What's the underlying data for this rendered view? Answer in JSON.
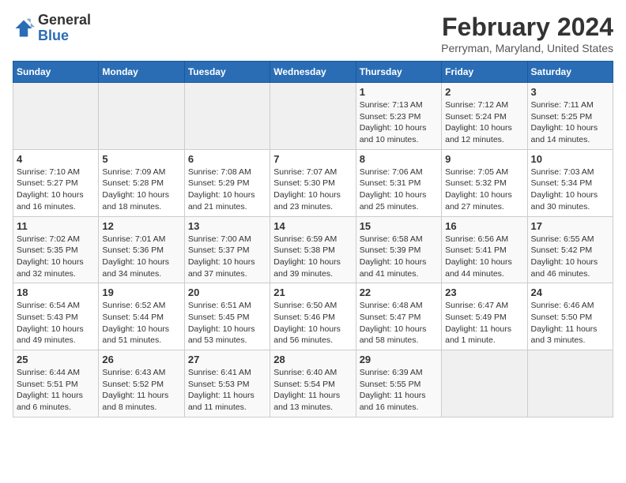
{
  "header": {
    "logo_general": "General",
    "logo_blue": "Blue",
    "month_title": "February 2024",
    "location": "Perryman, Maryland, United States"
  },
  "days_of_week": [
    "Sunday",
    "Monday",
    "Tuesday",
    "Wednesday",
    "Thursday",
    "Friday",
    "Saturday"
  ],
  "weeks": [
    [
      {
        "num": "",
        "detail": ""
      },
      {
        "num": "",
        "detail": ""
      },
      {
        "num": "",
        "detail": ""
      },
      {
        "num": "",
        "detail": ""
      },
      {
        "num": "1",
        "detail": "Sunrise: 7:13 AM\nSunset: 5:23 PM\nDaylight: 10 hours\nand 10 minutes."
      },
      {
        "num": "2",
        "detail": "Sunrise: 7:12 AM\nSunset: 5:24 PM\nDaylight: 10 hours\nand 12 minutes."
      },
      {
        "num": "3",
        "detail": "Sunrise: 7:11 AM\nSunset: 5:25 PM\nDaylight: 10 hours\nand 14 minutes."
      }
    ],
    [
      {
        "num": "4",
        "detail": "Sunrise: 7:10 AM\nSunset: 5:27 PM\nDaylight: 10 hours\nand 16 minutes."
      },
      {
        "num": "5",
        "detail": "Sunrise: 7:09 AM\nSunset: 5:28 PM\nDaylight: 10 hours\nand 18 minutes."
      },
      {
        "num": "6",
        "detail": "Sunrise: 7:08 AM\nSunset: 5:29 PM\nDaylight: 10 hours\nand 21 minutes."
      },
      {
        "num": "7",
        "detail": "Sunrise: 7:07 AM\nSunset: 5:30 PM\nDaylight: 10 hours\nand 23 minutes."
      },
      {
        "num": "8",
        "detail": "Sunrise: 7:06 AM\nSunset: 5:31 PM\nDaylight: 10 hours\nand 25 minutes."
      },
      {
        "num": "9",
        "detail": "Sunrise: 7:05 AM\nSunset: 5:32 PM\nDaylight: 10 hours\nand 27 minutes."
      },
      {
        "num": "10",
        "detail": "Sunrise: 7:03 AM\nSunset: 5:34 PM\nDaylight: 10 hours\nand 30 minutes."
      }
    ],
    [
      {
        "num": "11",
        "detail": "Sunrise: 7:02 AM\nSunset: 5:35 PM\nDaylight: 10 hours\nand 32 minutes."
      },
      {
        "num": "12",
        "detail": "Sunrise: 7:01 AM\nSunset: 5:36 PM\nDaylight: 10 hours\nand 34 minutes."
      },
      {
        "num": "13",
        "detail": "Sunrise: 7:00 AM\nSunset: 5:37 PM\nDaylight: 10 hours\nand 37 minutes."
      },
      {
        "num": "14",
        "detail": "Sunrise: 6:59 AM\nSunset: 5:38 PM\nDaylight: 10 hours\nand 39 minutes."
      },
      {
        "num": "15",
        "detail": "Sunrise: 6:58 AM\nSunset: 5:39 PM\nDaylight: 10 hours\nand 41 minutes."
      },
      {
        "num": "16",
        "detail": "Sunrise: 6:56 AM\nSunset: 5:41 PM\nDaylight: 10 hours\nand 44 minutes."
      },
      {
        "num": "17",
        "detail": "Sunrise: 6:55 AM\nSunset: 5:42 PM\nDaylight: 10 hours\nand 46 minutes."
      }
    ],
    [
      {
        "num": "18",
        "detail": "Sunrise: 6:54 AM\nSunset: 5:43 PM\nDaylight: 10 hours\nand 49 minutes."
      },
      {
        "num": "19",
        "detail": "Sunrise: 6:52 AM\nSunset: 5:44 PM\nDaylight: 10 hours\nand 51 minutes."
      },
      {
        "num": "20",
        "detail": "Sunrise: 6:51 AM\nSunset: 5:45 PM\nDaylight: 10 hours\nand 53 minutes."
      },
      {
        "num": "21",
        "detail": "Sunrise: 6:50 AM\nSunset: 5:46 PM\nDaylight: 10 hours\nand 56 minutes."
      },
      {
        "num": "22",
        "detail": "Sunrise: 6:48 AM\nSunset: 5:47 PM\nDaylight: 10 hours\nand 58 minutes."
      },
      {
        "num": "23",
        "detail": "Sunrise: 6:47 AM\nSunset: 5:49 PM\nDaylight: 11 hours\nand 1 minute."
      },
      {
        "num": "24",
        "detail": "Sunrise: 6:46 AM\nSunset: 5:50 PM\nDaylight: 11 hours\nand 3 minutes."
      }
    ],
    [
      {
        "num": "25",
        "detail": "Sunrise: 6:44 AM\nSunset: 5:51 PM\nDaylight: 11 hours\nand 6 minutes."
      },
      {
        "num": "26",
        "detail": "Sunrise: 6:43 AM\nSunset: 5:52 PM\nDaylight: 11 hours\nand 8 minutes."
      },
      {
        "num": "27",
        "detail": "Sunrise: 6:41 AM\nSunset: 5:53 PM\nDaylight: 11 hours\nand 11 minutes."
      },
      {
        "num": "28",
        "detail": "Sunrise: 6:40 AM\nSunset: 5:54 PM\nDaylight: 11 hours\nand 13 minutes."
      },
      {
        "num": "29",
        "detail": "Sunrise: 6:39 AM\nSunset: 5:55 PM\nDaylight: 11 hours\nand 16 minutes."
      },
      {
        "num": "",
        "detail": ""
      },
      {
        "num": "",
        "detail": ""
      }
    ]
  ]
}
